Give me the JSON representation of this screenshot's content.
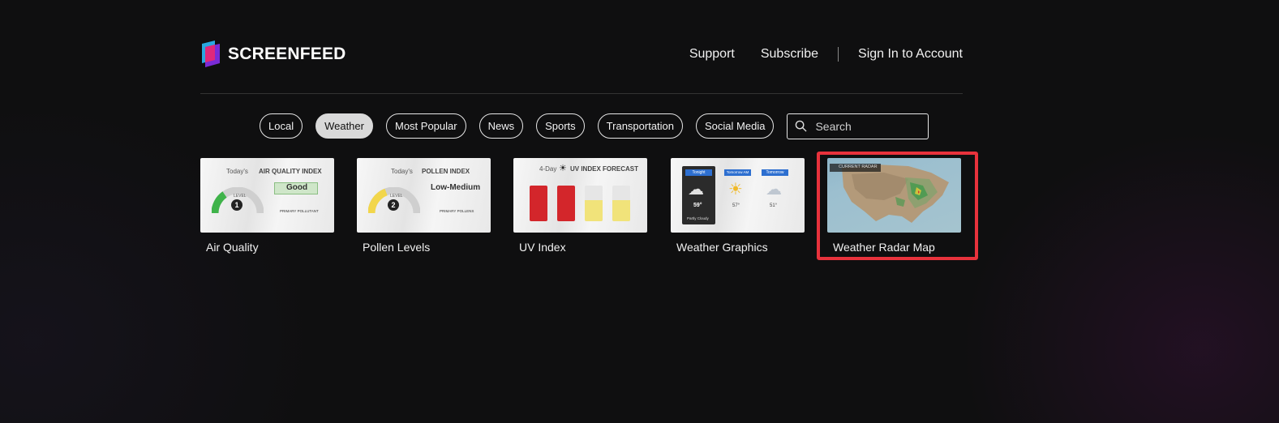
{
  "brand": {
    "name": "SCREENFEED"
  },
  "nav": {
    "support": "Support",
    "subscribe": "Subscribe",
    "sign_in": "Sign In to Account"
  },
  "filters": [
    {
      "label": "Local",
      "active": false
    },
    {
      "label": "Weather",
      "active": true
    },
    {
      "label": "Most Popular",
      "active": false
    },
    {
      "label": "News",
      "active": false
    },
    {
      "label": "Sports",
      "active": false
    },
    {
      "label": "Transportation",
      "active": false
    },
    {
      "label": "Social Media",
      "active": false
    }
  ],
  "search": {
    "placeholder": "Search"
  },
  "cards": [
    {
      "title": "Air Quality",
      "thumb": {
        "heading_prefix": "Today's",
        "heading": "AIR QUALITY INDEX",
        "status": "Good",
        "level_label": "LEVEL",
        "level": "1",
        "sub": "PRIMARY POLLUTANT"
      }
    },
    {
      "title": "Pollen Levels",
      "thumb": {
        "heading_prefix": "Today's",
        "heading": "POLLEN INDEX",
        "status": "Low-Medium",
        "level_label": "LEVEL",
        "level": "2",
        "sub": "PRIMARY POLLENS"
      }
    },
    {
      "title": "UV Index",
      "thumb": {
        "heading_prefix": "4-Day",
        "heading": "UV INDEX FORECAST"
      }
    },
    {
      "title": "Weather Graphics",
      "thumb": {
        "col1": "Tonight",
        "col2": "Tomorrow AM",
        "col3": "Tomorrow",
        "t1": "59°",
        "t2": "57°",
        "t3": "51°",
        "cond1": "Partly Cloudy"
      }
    },
    {
      "title": "Weather Radar Map",
      "selected": true,
      "thumb": {
        "badge": "CURRENT RADAR"
      }
    }
  ],
  "colors": {
    "highlight": "#e8323c",
    "aq_green": "#3fb34a",
    "pollen_yellow": "#f2d64b",
    "uv_red": "#d3262b",
    "uv_yellow": "#f1e37a",
    "badge_blue": "#2d6fd0"
  }
}
